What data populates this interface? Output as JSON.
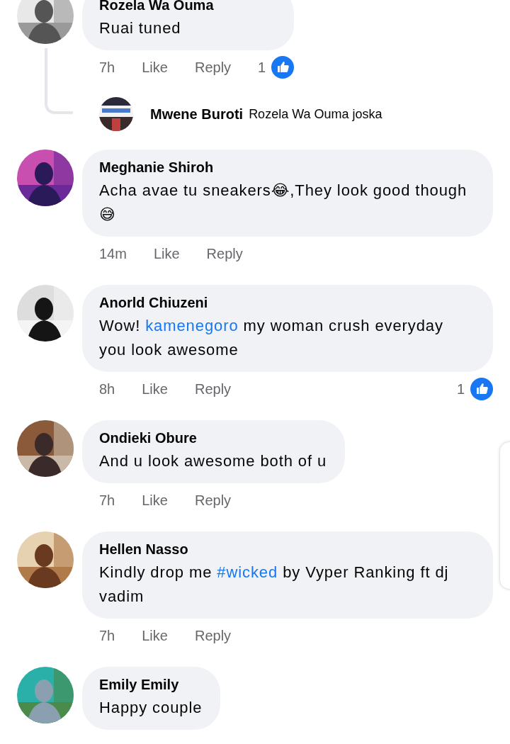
{
  "comments": [
    {
      "author": "Rozela Wa Ouma",
      "body": [
        {
          "kind": "plain",
          "text": "Ruai tuned"
        }
      ],
      "time": "7h",
      "like": "Like",
      "reply": "Reply",
      "reactions": "1",
      "replies": [
        {
          "author": "Mwene Buroti",
          "body": [
            {
              "kind": "plain",
              "text": "Rozela Wa Ouma joska"
            }
          ]
        }
      ]
    },
    {
      "author": "Meghanie Shiroh",
      "body": [
        {
          "kind": "plain",
          "text": "Acha avae tu sneakers😂,They look good though 😅"
        }
      ],
      "time": "14m",
      "like": "Like",
      "reply": "Reply"
    },
    {
      "author": "Anorld Chiuzeni",
      "body": [
        {
          "kind": "plain",
          "text": "Wow! "
        },
        {
          "kind": "link",
          "text": "kamenegoro"
        },
        {
          "kind": "plain",
          "text": " my woman crush everyday you look awesome"
        }
      ],
      "time": "8h",
      "like": "Like",
      "reply": "Reply",
      "reactions": "1"
    },
    {
      "author": "Ondieki Obure",
      "body": [
        {
          "kind": "plain",
          "text": "And u look awesome both of u"
        }
      ],
      "time": "7h",
      "like": "Like",
      "reply": "Reply"
    },
    {
      "author": "Hellen Nasso",
      "body": [
        {
          "kind": "plain",
          "text": "Kindly drop me "
        },
        {
          "kind": "link",
          "text": "#wicked"
        },
        {
          "kind": "plain",
          "text": " by Vyper Ranking ft dj vadim"
        }
      ],
      "time": "7h",
      "like": "Like",
      "reply": "Reply"
    },
    {
      "author": "Emily Emily",
      "body": [
        {
          "kind": "plain",
          "text": "Happy couple"
        }
      ]
    }
  ]
}
